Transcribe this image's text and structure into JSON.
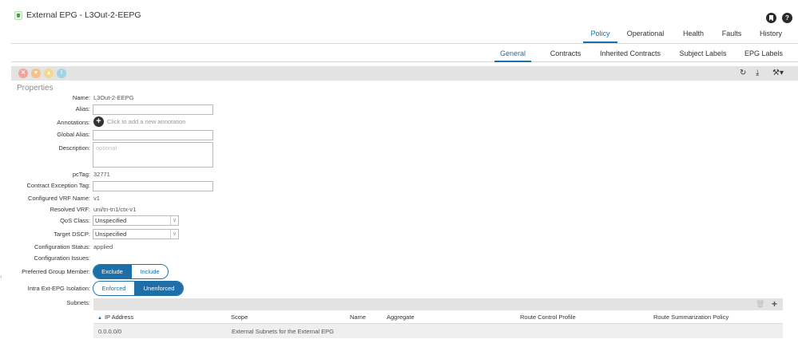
{
  "header": {
    "title": "External EPG - L3Out-2-EEPG",
    "help_glyph": "?",
    "tabs": [
      {
        "label": "Policy",
        "active": true
      },
      {
        "label": "Operational",
        "active": false
      },
      {
        "label": "Health",
        "active": false
      },
      {
        "label": "Faults",
        "active": false
      },
      {
        "label": "History",
        "active": false
      }
    ]
  },
  "subtabs": [
    {
      "label": "General",
      "active": true
    },
    {
      "label": "Contracts",
      "active": false
    },
    {
      "label": "Inherited Contracts",
      "active": false
    },
    {
      "label": "Subject Labels",
      "active": false
    },
    {
      "label": "EPG Labels",
      "active": false
    }
  ],
  "toolbar": {
    "fault_icons": [
      "critical-fault-icon",
      "major-fault-icon",
      "minor-fault-icon",
      "warning-fault-icon"
    ],
    "refresh_glyph": "↻",
    "download_glyph": "⤓",
    "tools_glyph": "⚒▾"
  },
  "properties": {
    "section_title": "Properties",
    "name": {
      "label": "Name:",
      "value": "L3Out-2-EEPG"
    },
    "alias": {
      "label": "Alias:",
      "value": ""
    },
    "annotations": {
      "label": "Annotations:",
      "hint": "Click to add a new annotation",
      "add_glyph": "+"
    },
    "global_alias": {
      "label": "Global Alias:",
      "value": ""
    },
    "description": {
      "label": "Description:",
      "placeholder": "optional"
    },
    "pctag": {
      "label": "pcTag:",
      "value": "32771"
    },
    "contract_exception_tag": {
      "label": "Contract Exception Tag:",
      "value": ""
    },
    "configured_vrf": {
      "label": "Configured VRF Name:",
      "value": "v1"
    },
    "resolved_vrf": {
      "label": "Resolved VRF:",
      "value": "uni/tn-tn1/ctx-v1"
    },
    "qos_class": {
      "label": "QoS Class:",
      "value": "Unspecified"
    },
    "target_dscp": {
      "label": "Target DSCP:",
      "value": "Unspecified"
    },
    "config_status": {
      "label": "Configuration Status:",
      "value": "applied"
    },
    "config_issues": {
      "label": "Configuration Issues:",
      "value": ""
    },
    "preferred_group": {
      "label": "Preferred Group Member:",
      "options": [
        "Exclude",
        "Include"
      ],
      "selected": "Exclude"
    },
    "intra_isolation": {
      "label": "Intra Ext-EPG Isolation:",
      "options": [
        "Enforced",
        "Unenforced"
      ],
      "selected": "Unenforced"
    },
    "subnets_label": "Subnets:"
  },
  "subnets": {
    "sort_glyph": "▲",
    "trash_glyph": "🗑",
    "add_glyph": "+",
    "columns": [
      "IP Address",
      "Scope",
      "Name",
      "Aggregate",
      "Route Control Profile",
      "Route Summarization Policy"
    ],
    "rows": [
      {
        "ip": "0.0.0.0/0",
        "scope": "External Subnets for the External EPG",
        "name": "",
        "aggregate": "",
        "route_control_profile": "",
        "route_summarization_policy": ""
      }
    ]
  },
  "colors": {
    "accent": "#1e6fa8",
    "toolbar_bg": "#e3e3e3"
  }
}
